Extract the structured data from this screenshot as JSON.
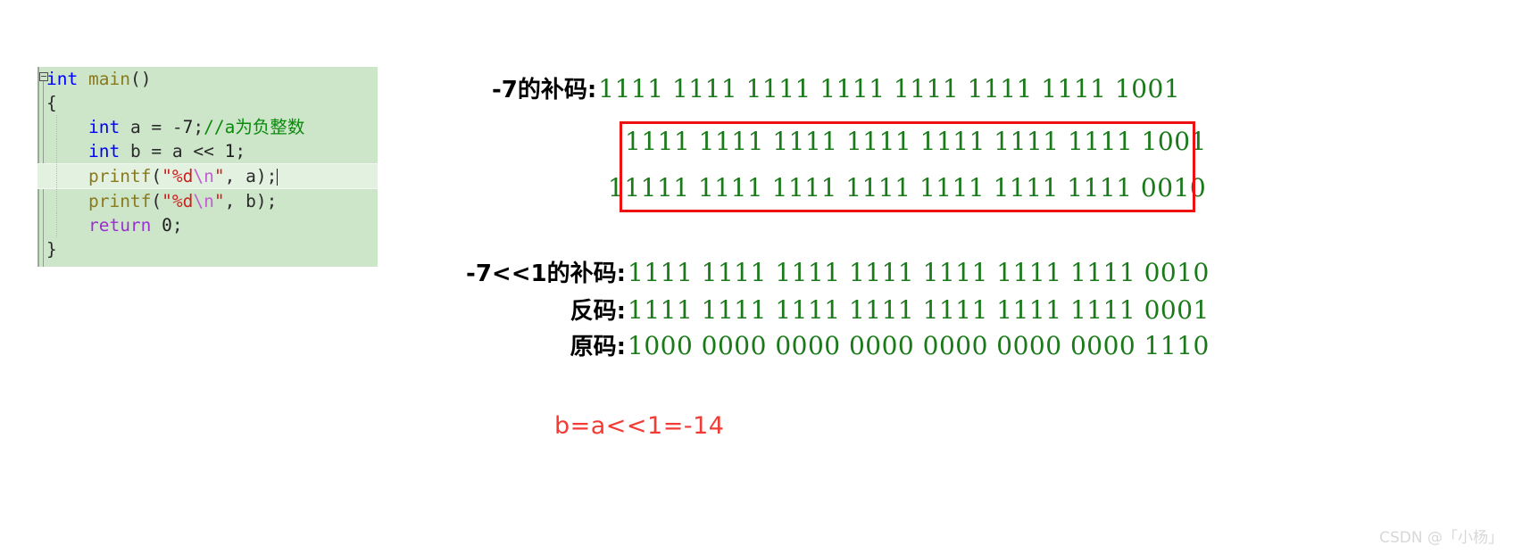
{
  "code_editor": {
    "lines": [
      {
        "id": "line-main",
        "tokens": [
          {
            "t": "kw",
            "v": "int"
          },
          {
            "t": "pun",
            "v": " "
          },
          {
            "t": "fn",
            "v": "main"
          },
          {
            "t": "pun",
            "v": "()"
          }
        ]
      },
      {
        "id": "line-open",
        "tokens": [
          {
            "t": "pun",
            "v": "{"
          }
        ]
      },
      {
        "id": "line-a",
        "tokens": [
          {
            "t": "pun",
            "v": "    "
          },
          {
            "t": "kw",
            "v": "int"
          },
          {
            "t": "pun",
            "v": " a = -"
          },
          {
            "t": "num",
            "v": "7"
          },
          {
            "t": "pun",
            "v": ";"
          },
          {
            "t": "cmt",
            "v": "//a为负整数"
          }
        ]
      },
      {
        "id": "line-b",
        "tokens": [
          {
            "t": "pun",
            "v": "    "
          },
          {
            "t": "kw",
            "v": "int"
          },
          {
            "t": "pun",
            "v": " b = a << "
          },
          {
            "t": "num",
            "v": "1"
          },
          {
            "t": "pun",
            "v": ";"
          }
        ]
      },
      {
        "id": "line-printf-a",
        "tokens": [
          {
            "t": "pun",
            "v": "    "
          },
          {
            "t": "fn",
            "v": "printf"
          },
          {
            "t": "pun",
            "v": "("
          },
          {
            "t": "str",
            "v": "\"%d"
          },
          {
            "t": "esc",
            "v": "\\n"
          },
          {
            "t": "str",
            "v": "\""
          },
          {
            "t": "pun",
            "v": ", a);"
          }
        ],
        "highlight": true,
        "caret": true
      },
      {
        "id": "line-printf-b",
        "tokens": [
          {
            "t": "pun",
            "v": "    "
          },
          {
            "t": "fn",
            "v": "printf"
          },
          {
            "t": "pun",
            "v": "("
          },
          {
            "t": "str",
            "v": "\"%d"
          },
          {
            "t": "esc",
            "v": "\\n"
          },
          {
            "t": "str",
            "v": "\""
          },
          {
            "t": "pun",
            "v": ", b);"
          }
        ]
      },
      {
        "id": "line-return",
        "tokens": [
          {
            "t": "pun",
            "v": "    "
          },
          {
            "t": "ret",
            "v": "return"
          },
          {
            "t": "pun",
            "v": " "
          },
          {
            "t": "num",
            "v": "0"
          },
          {
            "t": "pun",
            "v": ";"
          }
        ]
      },
      {
        "id": "line-close",
        "tokens": [
          {
            "t": "pun",
            "v": "}"
          }
        ]
      }
    ],
    "raw_text": "int main()\n{\n    int a = -7;//a为负整数\n    int b = a << 1;\n    printf(\"%d\\n\", a);\n    printf(\"%d\\n\", b);\n    return 0;\n}",
    "background_color": "#cde6ca",
    "highlight_color": "#e3f2e0"
  },
  "binary_rows": {
    "complement_of_minus7": {
      "label": "-7的补码:",
      "digits": "1111 1111 1111 1111 1111 1111 1111 1001"
    },
    "box_before": {
      "label": "",
      "digits": "1111 1111 1111 1111 1111 1111 1111 1001"
    },
    "box_after": {
      "label": "",
      "shifted_out_bit": "1",
      "digits": "1111 1111 1111 1111 1111 1111 1111 001",
      "new_bit": "0"
    },
    "shift_complement": {
      "label": "-7<<1的补码:",
      "digits": "1111 1111 1111 1111 1111 1111 1111 0010"
    },
    "inverse_code": {
      "label": "反码:",
      "digits": "1111 1111 1111 1111 1111 1111 1111 0001"
    },
    "original_code": {
      "label": "原码:",
      "digits": "1000 0000 0000 0000 0000 0000 0000 1110"
    }
  },
  "result": {
    "text": "b=a<<1=-14",
    "color": "#f23b35"
  },
  "highlight_box": {
    "color": "#ee1111"
  },
  "watermark": {
    "text": "CSDN @「小杨」"
  }
}
